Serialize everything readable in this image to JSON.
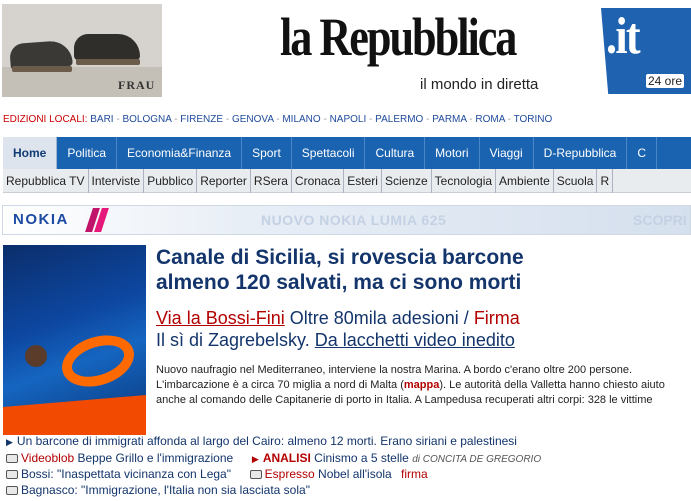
{
  "top_ad": {
    "brand": "FRAU"
  },
  "masthead": {
    "logo": "la Repubblica",
    "logo_tld": ".it",
    "tagline": "il mondo in diretta",
    "badge": "24 ore"
  },
  "editions": {
    "label": "EDIZIONI LOCALI:",
    "cities": [
      "BARI",
      "BOLOGNA",
      "FIRENZE",
      "GENOVA",
      "MILANO",
      "NAPOLI",
      "PALERMO",
      "PARMA",
      "ROMA",
      "TORINO"
    ]
  },
  "main_nav": [
    "Home",
    "Politica",
    "Economia&Finanza",
    "Sport",
    "Spettacoli",
    "Cultura",
    "Motori",
    "Viaggi",
    "D-Repubblica",
    "C"
  ],
  "sub_nav": [
    "Repubblica TV",
    "Interviste",
    "Pubblico",
    "Reporter",
    "RSera",
    "Cronaca",
    "Esteri",
    "Scienze",
    "Tecnologia",
    "Ambiente",
    "Scuola",
    "R"
  ],
  "ad": {
    "brand": "NOKIA",
    "text": "NUOVO NOKIA LUMIA 625",
    "cta": "SCOPRI"
  },
  "hero": {
    "headline_l1": "Canale di Sicilia, si rovescia barcone",
    "headline_l2": "almeno 120 salvati, ma ci sono morti",
    "link1": "Via la Bossi-Fini",
    "link1_rest": " Oltre 80mila adesioni / ",
    "link1_firma": "Firma",
    "link2_pre": "Il sì di Zagrebelsky. ",
    "link2": "Da lacchetti video inedito",
    "lead_1": "Nuovo naufragio nel Mediterraneo, interviene la nostra Marina. A bordo c'erano oltre 200 persone. L'imbarcazione è a circa 70 miglia a nord di Malta (",
    "lead_map": "mappa",
    "lead_2": "). Le autorità della Valletta hanno chiesto aiuto anche al comando  delle Capitanerie di porto in Italia. A Lampedusa recuperati altri corpi: 328 le vittime"
  },
  "related": {
    "r1": "Un barcone di immigrati affonda al largo del Cairo: almeno 12 morti. Erano siriani e palestinesi",
    "r2_a": "Videoblob",
    "r2_b": " Beppe Grillo e l'immigrazione",
    "r2_c": "ANALISI",
    "r2_d": " Cinismo a 5 stelle",
    "r2_e": "di CONCITA DE GREGORIO",
    "r3_a": "Bossi: \"Inaspettata vicinanza con Lega\"",
    "r3_b": "Espresso",
    "r3_c": " Nobel all'isola",
    "r3_d": "firma",
    "r4": "Bagnasco: \"Immigrazione, l'Italia non sia lasciata sola\""
  }
}
